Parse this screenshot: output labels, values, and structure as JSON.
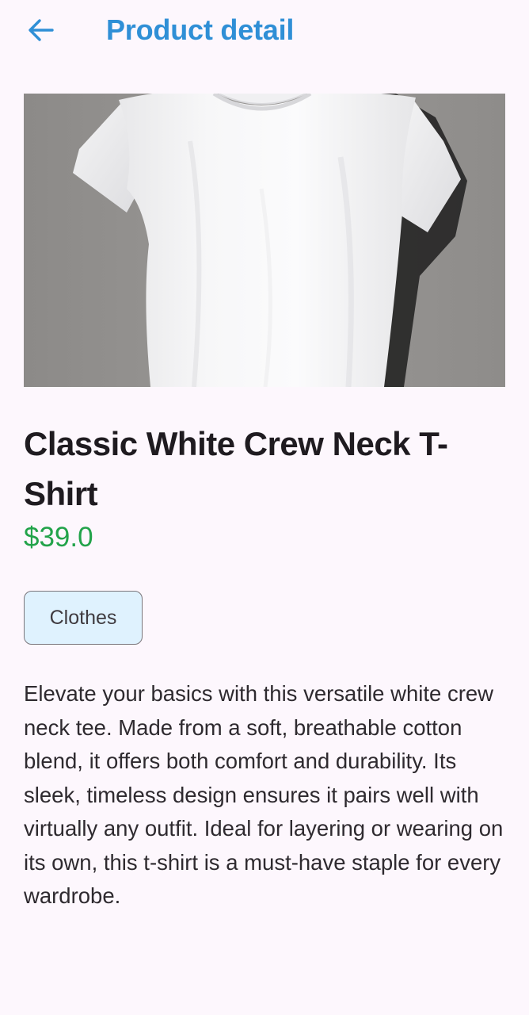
{
  "header": {
    "back_icon": "arrow-left-icon",
    "title": "Product detail",
    "accent_color": "#2f8fd6"
  },
  "product": {
    "image_subject": "white-t-shirt-image",
    "name": "Classic White Crew Neck T-Shirt",
    "price": "$39.0",
    "price_color": "#22a34a",
    "category": "Clothes",
    "description": "Elevate your basics with this versatile white crew neck tee. Made from a soft, breathable cotton blend, it offers both comfort and durability. Its sleek, timeless design ensures it pairs well with virtually any outfit. Ideal for layering or wearing on its own, this t-shirt is a must-have staple for every wardrobe."
  }
}
